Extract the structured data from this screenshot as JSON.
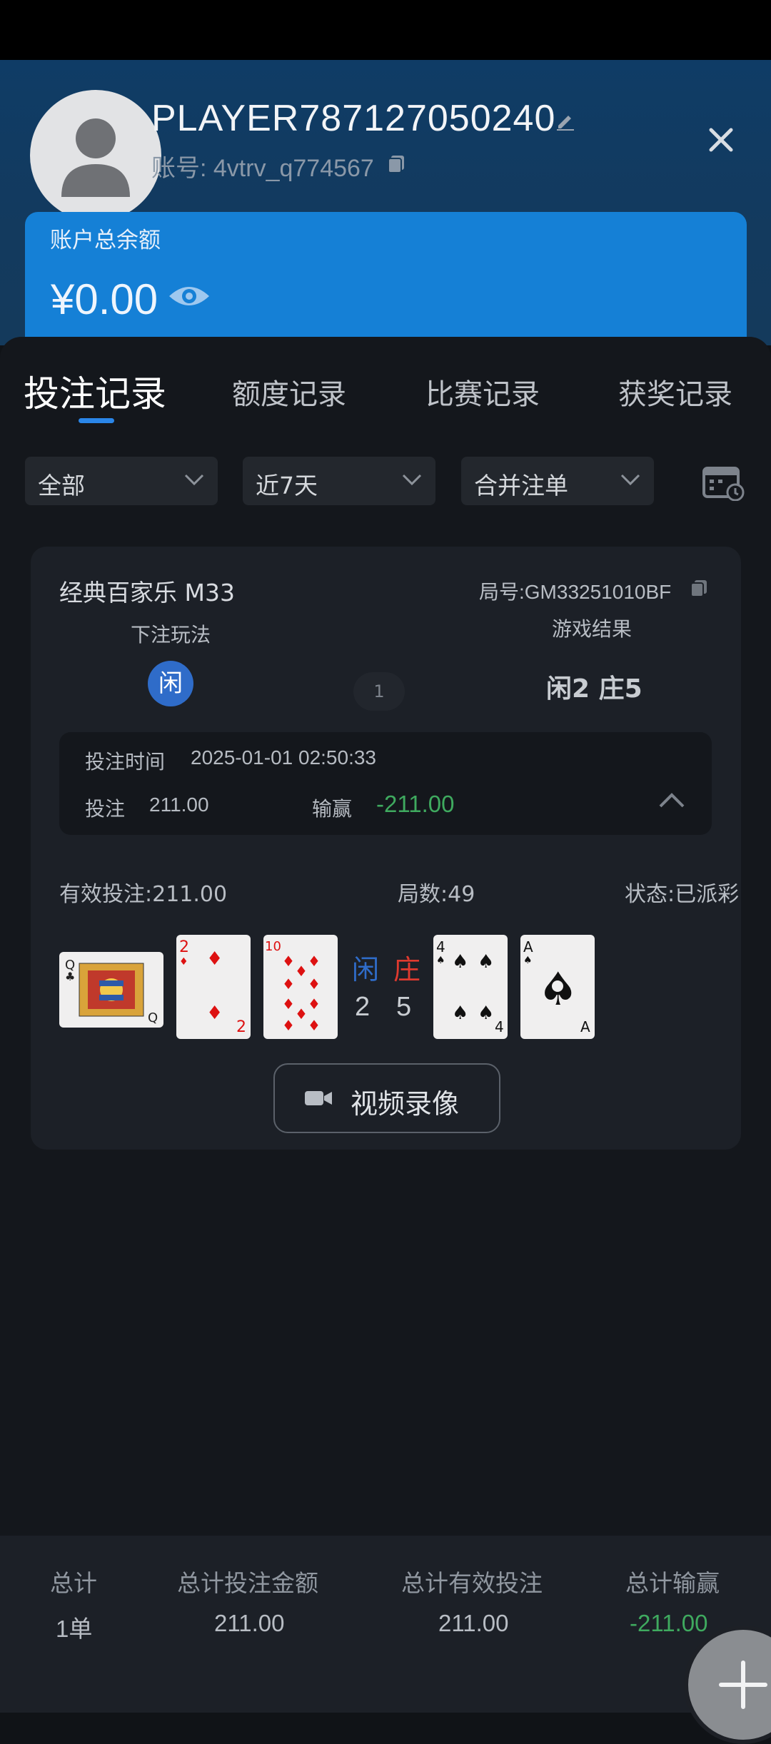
{
  "profile": {
    "username": "PLAYER787127050240",
    "account_label": "账号: 4vtrv_q774567"
  },
  "balance": {
    "label": "账户总余额",
    "value": "¥0.00"
  },
  "tabs": [
    {
      "label": "投注记录",
      "active": true
    },
    {
      "label": "额度记录",
      "active": false
    },
    {
      "label": "比赛记录",
      "active": false
    },
    {
      "label": "获奖记录",
      "active": false
    }
  ],
  "filters": [
    {
      "value": "全部"
    },
    {
      "value": "近7天"
    },
    {
      "value": "合并注单"
    }
  ],
  "record": {
    "game_name": "经典百家乐 M33",
    "round_id": "局号:GM33251010BF",
    "bet_type_label": "下注玩法",
    "bet_choice": "闲",
    "bet_count": "1",
    "result_label": "游戏结果",
    "result_value": "闲2 庄5",
    "bet_time_label": "投注时间",
    "bet_time": "2025-01-01 02:50:33",
    "stake_label": "投注",
    "stake": "211.00",
    "winloss_label": "输赢",
    "winloss": "-211.00",
    "valid_bet": "有效投注:211.00",
    "rounds": "局数:49",
    "status": "状态:已派彩",
    "player_label": "闲",
    "banker_label": "庄",
    "player_score": "2",
    "banker_score": "5",
    "player_cards": [
      "Q♣",
      "2♦",
      "10♦"
    ],
    "banker_cards": [
      "4♠",
      "A♠"
    ],
    "video_label": "视频录像"
  },
  "colors": {
    "accent": "#1580d6",
    "player": "#2f6cc9",
    "banker": "#e03a2f",
    "loss": "#3faa5f"
  },
  "footer": {
    "total_label": "总计",
    "total_value": "1单",
    "bet_amount_label": "总计投注金额",
    "bet_amount_value": "211.00",
    "valid_bet_label": "总计有效投注",
    "valid_bet_value": "211.00",
    "winloss_label": "总计输赢",
    "winloss_value": "-211.00"
  }
}
